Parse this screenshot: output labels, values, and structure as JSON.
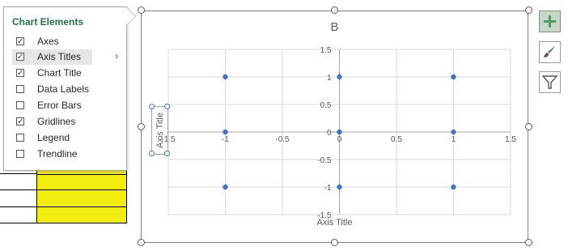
{
  "flyout": {
    "title": "Chart Elements",
    "items": [
      {
        "label": "Axes",
        "checked": true
      },
      {
        "label": "Axis Titles",
        "checked": true,
        "has_submenu": true,
        "hover": true
      },
      {
        "label": "Chart Title",
        "checked": true
      },
      {
        "label": "Data Labels",
        "checked": false
      },
      {
        "label": "Error Bars",
        "checked": false
      },
      {
        "label": "Gridlines",
        "checked": true
      },
      {
        "label": "Legend",
        "checked": false
      },
      {
        "label": "Trendline",
        "checked": false
      }
    ],
    "submenu_glyph": "›"
  },
  "side_buttons": {
    "chart_elements_icon": "plus-icon",
    "chart_styles_icon": "paintbrush-icon",
    "chart_filters_icon": "funnel-icon"
  },
  "chart": {
    "title": "B",
    "x_axis_title": "Axis Title",
    "y_axis_title": "Axis Title"
  },
  "chart_data": {
    "type": "scatter",
    "title": "B",
    "xlabel": "Axis Title",
    "ylabel": "Axis Title",
    "xlim": [
      -1.5,
      1.5
    ],
    "ylim": [
      -1.5,
      1.5
    ],
    "x_ticks": [
      -1.5,
      -1,
      -0.5,
      0,
      0.5,
      1,
      1.5
    ],
    "y_ticks": [
      1.5,
      1,
      0.5,
      0,
      -0.5,
      -1,
      -1.5
    ],
    "x_tick_labels": [
      "-1.5",
      "-1",
      "-0.5",
      "0",
      "0.5",
      "1",
      "1.5"
    ],
    "y_tick_labels": [
      "1.5",
      "1",
      "0.5",
      "0",
      "-0.5",
      "-1",
      "-1.5"
    ],
    "grid": true,
    "legend": false,
    "series": [
      {
        "color": "#4472c4",
        "x": [
          -1,
          0,
          1,
          -1,
          0,
          1,
          -1,
          0,
          1
        ],
        "y": [
          1,
          1,
          1,
          0,
          0,
          0,
          -1,
          -1,
          -1
        ]
      }
    ]
  }
}
